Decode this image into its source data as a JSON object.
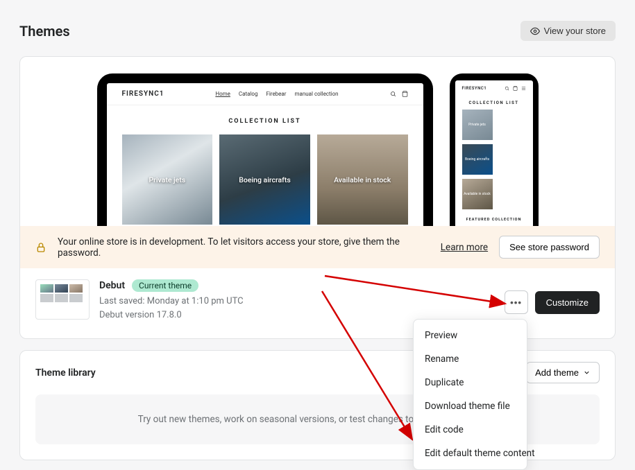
{
  "page": {
    "title": "Themes",
    "view_store": "View your store"
  },
  "preview": {
    "brand": "FIRESYNC1",
    "nav": [
      "Home",
      "Catalog",
      "Firebear",
      "manual collection"
    ],
    "collection_list_title": "COLLECTION LIST",
    "collections": [
      "Private jets",
      "Boeing aircrafts",
      "Available in stock"
    ],
    "mobile": {
      "brand": "FIRESYNC1",
      "collection_list_title": "COLLECTION LIST",
      "featured_title": "FEATURED COLLECTION"
    }
  },
  "dev_banner": {
    "message": "Your online store is in development. To let visitors access your store, give them the password.",
    "learn_more": "Learn more",
    "see_password": "See store password"
  },
  "current_theme": {
    "name": "Debut",
    "badge": "Current theme",
    "last_saved": "Last saved: Monday at 1:10 pm UTC",
    "version": "Debut version 17.8.0",
    "customize": "Customize"
  },
  "more_menu": {
    "items": [
      "Preview",
      "Rename",
      "Duplicate",
      "Download theme file",
      "Edit code",
      "Edit default theme content"
    ]
  },
  "library": {
    "title": "Theme library",
    "add": "Add theme",
    "empty": "Try out new themes, work on seasonal versions, or test changes to your current theme."
  }
}
